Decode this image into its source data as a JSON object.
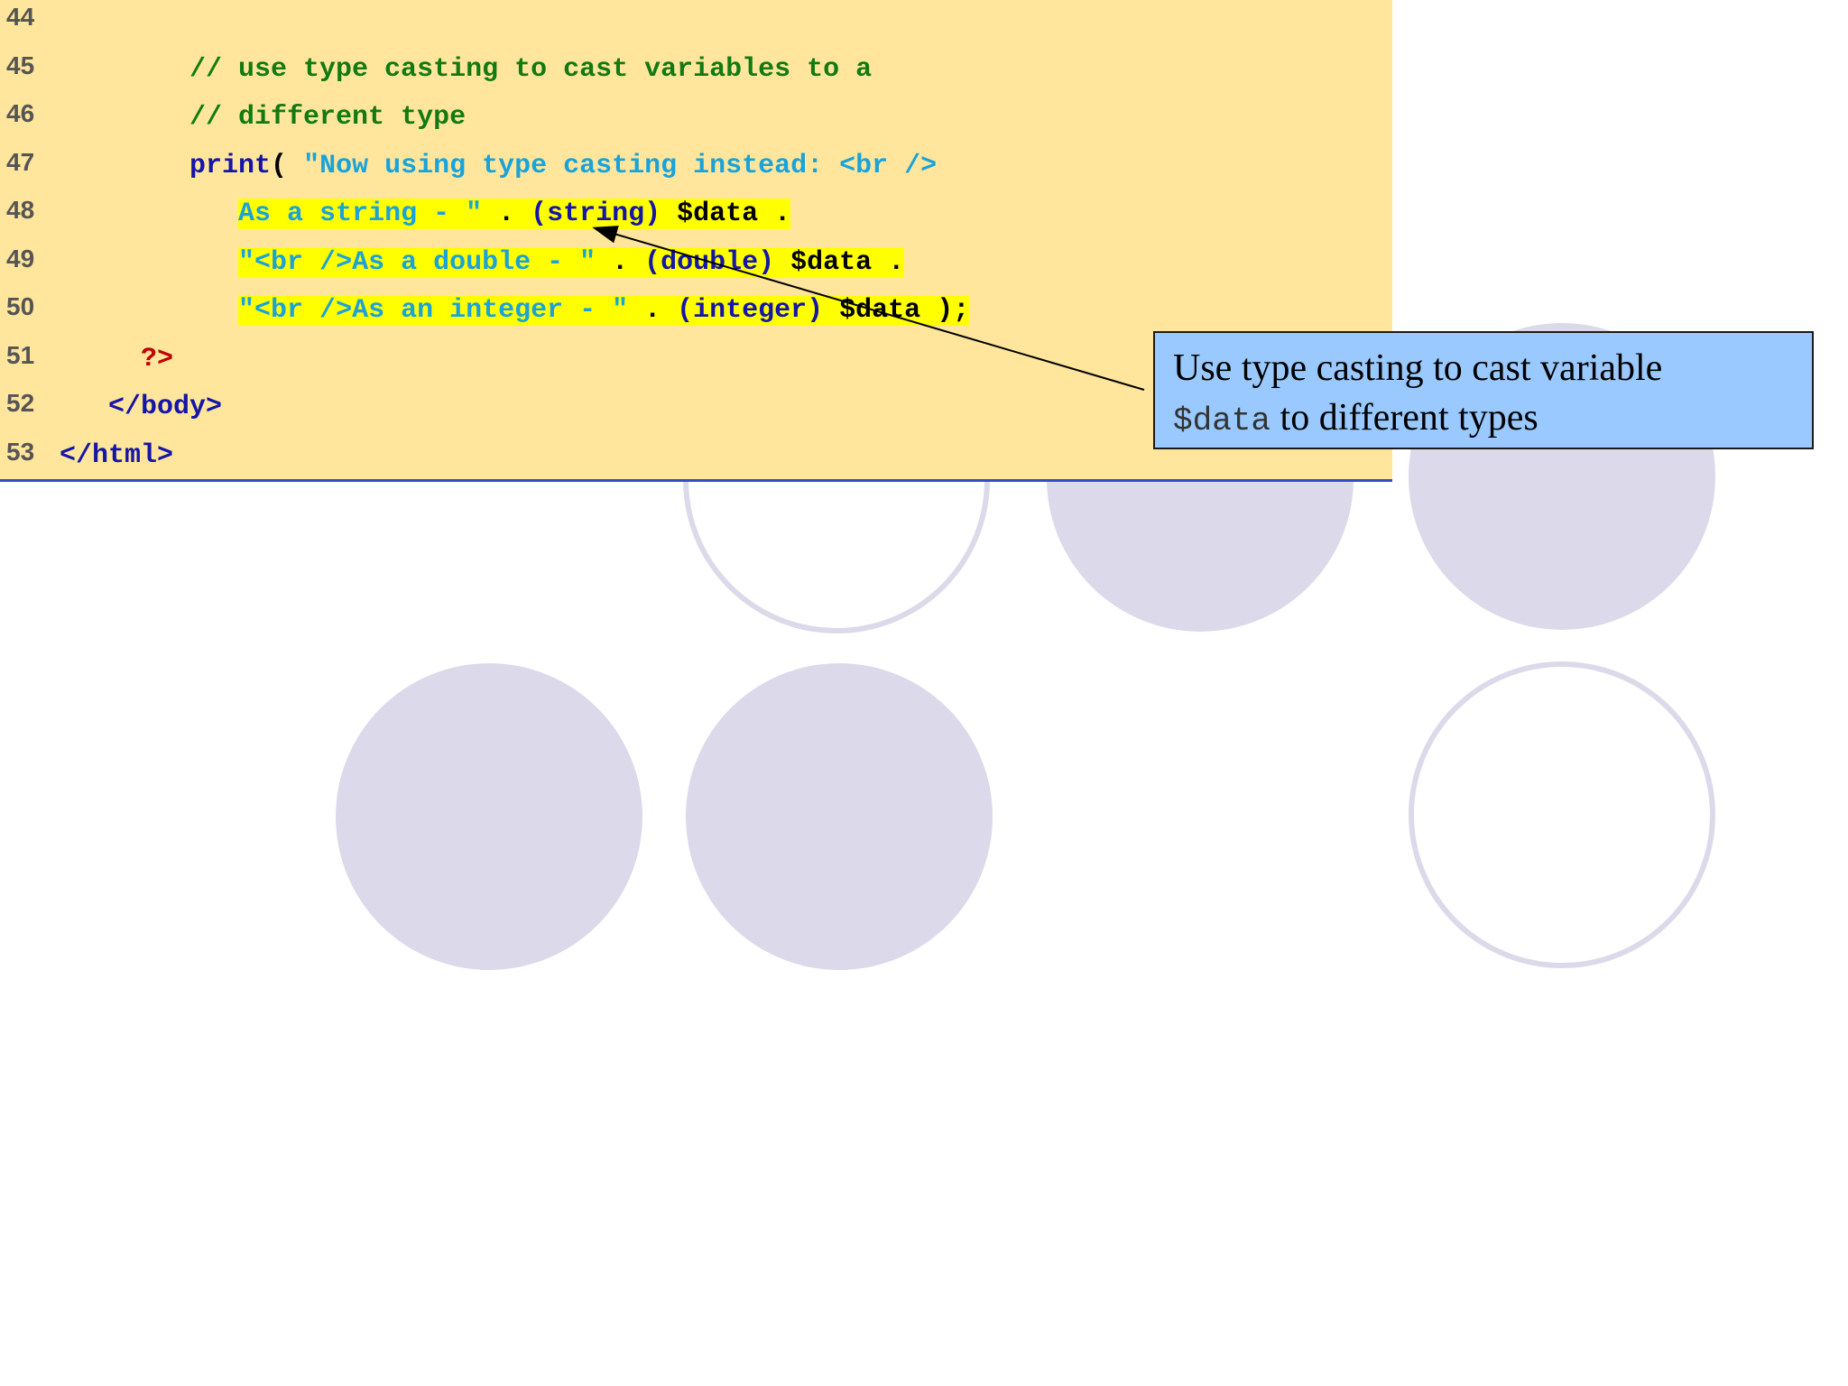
{
  "code": {
    "lines": [
      {
        "num": "44",
        "segments": []
      },
      {
        "num": "45",
        "segments": [
          {
            "text": "        // use type casting to cast variables to a",
            "color": "comment",
            "hl": false
          }
        ]
      },
      {
        "num": "46",
        "segments": [
          {
            "text": "        // different type",
            "color": "comment",
            "hl": false
          }
        ]
      },
      {
        "num": "47",
        "segments": [
          {
            "text": "        ",
            "color": "plain",
            "hl": false
          },
          {
            "text": "print",
            "color": "keyword",
            "hl": false
          },
          {
            "text": "( ",
            "color": "plain",
            "hl": false
          },
          {
            "text": "\"Now using type casting instead: <br />",
            "color": "string",
            "hl": false
          }
        ]
      },
      {
        "num": "48",
        "segments": [
          {
            "text": "           ",
            "color": "plain",
            "hl": false
          },
          {
            "text": "As a string - \"",
            "color": "string",
            "hl": true
          },
          {
            "text": " . ",
            "color": "plain",
            "hl": true
          },
          {
            "text": "(string) ",
            "color": "keyword",
            "hl": true
          },
          {
            "text": "$data .",
            "color": "plain",
            "hl": true
          }
        ]
      },
      {
        "num": "49",
        "segments": [
          {
            "text": "           ",
            "color": "plain",
            "hl": false
          },
          {
            "text": "\"<br />As a double - \"",
            "color": "string",
            "hl": true
          },
          {
            "text": " . ",
            "color": "plain",
            "hl": true
          },
          {
            "text": "(double) ",
            "color": "keyword",
            "hl": true
          },
          {
            "text": "$data .",
            "color": "plain",
            "hl": true
          }
        ]
      },
      {
        "num": "50",
        "segments": [
          {
            "text": "           ",
            "color": "plain",
            "hl": false
          },
          {
            "text": "\"<br />As an integer - \"",
            "color": "string",
            "hl": true
          },
          {
            "text": " . ",
            "color": "plain",
            "hl": true
          },
          {
            "text": "(integer) ",
            "color": "keyword",
            "hl": true
          },
          {
            "text": "$data );",
            "color": "plain",
            "hl": true
          }
        ]
      },
      {
        "num": "51",
        "segments": [
          {
            "text": "     ",
            "color": "plain",
            "hl": false
          },
          {
            "text": "?>",
            "color": "php",
            "hl": false
          }
        ]
      },
      {
        "num": "52",
        "segments": [
          {
            "text": "   ",
            "color": "plain",
            "hl": false
          },
          {
            "text": "</body>",
            "color": "tag",
            "hl": false
          }
        ]
      },
      {
        "num": "53",
        "segments": [
          {
            "text": "</html>",
            "color": "tag",
            "hl": false
          }
        ]
      }
    ]
  },
  "callout": {
    "line1": "Use type casting to cast variable",
    "code": "$data",
    "line2_rest": " to different types"
  },
  "colors": {
    "code_background": "#ffe69c",
    "highlight": "#ffff00",
    "callout_background": "#99c9ff",
    "decor_circle": "#dcd9ea",
    "comment": "#127a12",
    "keyword": "#1515a8",
    "string": "#1aa3d9",
    "php_tag": "#c00000"
  }
}
